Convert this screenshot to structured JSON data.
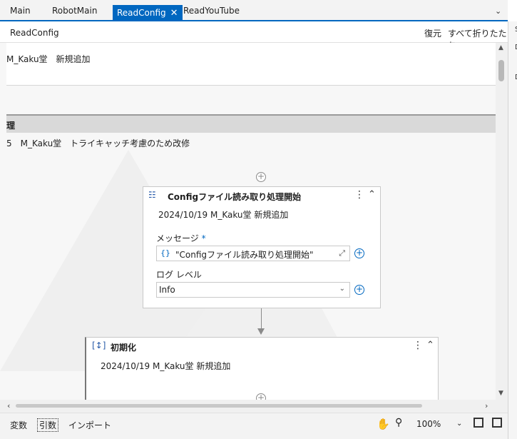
{
  "tabs": [
    {
      "label": "Main"
    },
    {
      "label": "RobotMain"
    },
    {
      "label": "ReadConfig"
    },
    {
      "label": "ReadYouTube"
    }
  ],
  "designer": {
    "title": "ReadConfig",
    "restore_label": "復元",
    "collapse_all_label": "すべて折りたたむ"
  },
  "canvas": {
    "top_annotation": "M_Kaku堂　新規追加",
    "section_header": "理",
    "section_annotation": "5　M_Kaku堂　トライキャッチ考慮のため改修"
  },
  "log_activity": {
    "title": "Configファイル読み取り処理開始",
    "annotation": "2024/10/19 M_Kaku堂 新規追加",
    "message_label": "メッセージ",
    "required_mark": "*",
    "message_value": "\"Configファイル読み取り処理開始\"",
    "brace_icon_text": "{}",
    "log_level_label": "ログ レベル",
    "log_level_value": "Info"
  },
  "init_activity": {
    "title": "初期化",
    "annotation": "2024/10/19 M_Kaku堂 新規追加"
  },
  "bottom": {
    "variables_label": "変数",
    "arguments_label": "引数",
    "imports_label": "インポート",
    "zoom": "100%"
  },
  "right_panel": {
    "glyphs": [
      "S",
      "D",
      "D"
    ]
  },
  "colors": {
    "accent": "#0067c0",
    "canvas_bg": "#f7f7f7",
    "header_gray": "#d9d9d9"
  }
}
